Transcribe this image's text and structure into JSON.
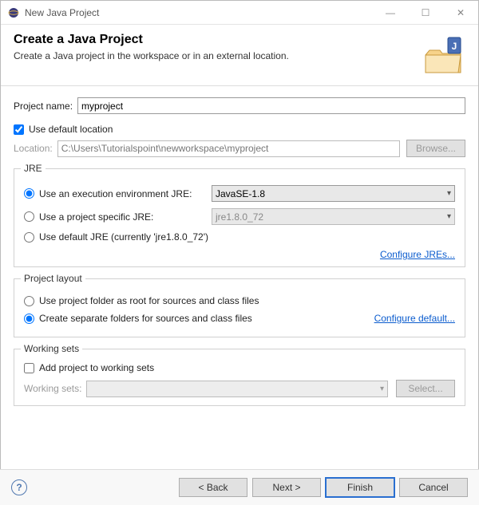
{
  "window": {
    "title": "New Java Project"
  },
  "header": {
    "title": "Create a Java Project",
    "desc": "Create a Java project in the workspace or in an external location."
  },
  "projectName": {
    "label": "Project name:",
    "value": "myproject"
  },
  "defaultLocation": {
    "label": "Use default location"
  },
  "location": {
    "label": "Location:",
    "value": "C:\\Users\\Tutorialspoint\\newworkspace\\myproject",
    "browse": "Browse..."
  },
  "jre": {
    "groupTitle": "JRE",
    "execEnvLabel": "Use an execution environment JRE:",
    "execEnvValue": "JavaSE-1.8",
    "projectSpecificLabel": "Use a project specific JRE:",
    "projectSpecificValue": "jre1.8.0_72",
    "defaultJreLabel": "Use default JRE (currently 'jre1.8.0_72')",
    "configureLink": "Configure JREs..."
  },
  "layout": {
    "groupTitle": "Project layout",
    "rootLabel": "Use project folder as root for sources and class files",
    "separateLabel": "Create separate folders for sources and class files",
    "configureLink": "Configure default..."
  },
  "workingSets": {
    "groupTitle": "Working sets",
    "addLabel": "Add project to working sets",
    "wsLabel": "Working sets:",
    "selectBtn": "Select..."
  },
  "footer": {
    "back": "< Back",
    "next": "Next >",
    "finish": "Finish",
    "cancel": "Cancel"
  }
}
